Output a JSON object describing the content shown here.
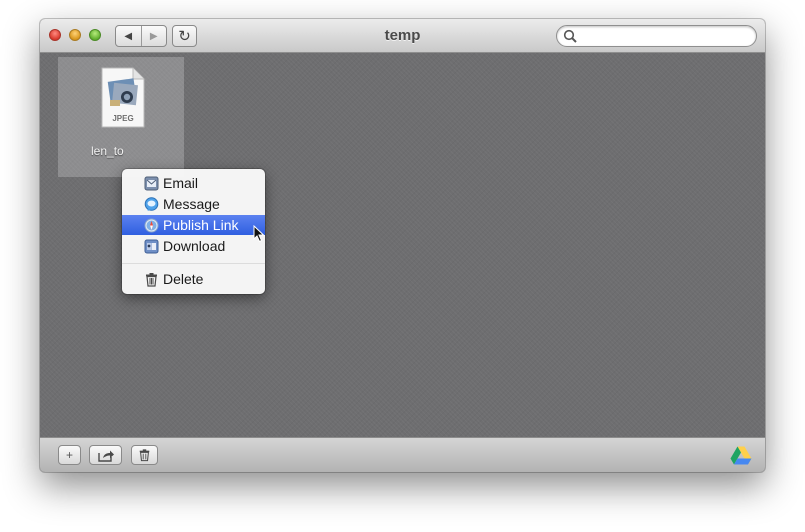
{
  "window": {
    "title": "temp"
  },
  "toolbar": {
    "back_icon": "back-arrow-icon",
    "forward_icon": "forward-arrow-icon",
    "refresh_icon": "refresh-icon"
  },
  "search": {
    "value": "",
    "placeholder": "",
    "icon": "search-icon"
  },
  "file": {
    "name": "len_to",
    "icon_label": "JPEG",
    "icon": "jpeg-file-icon"
  },
  "context_menu": {
    "items": [
      {
        "label": "Email",
        "icon": "mail-icon",
        "selected": false
      },
      {
        "label": "Message",
        "icon": "message-bubble-icon",
        "selected": false
      },
      {
        "label": "Publish Link",
        "icon": "safari-compass-icon",
        "selected": true
      },
      {
        "label": "Download",
        "icon": "download-icon",
        "selected": false
      },
      {
        "label": "Delete",
        "icon": "trash-icon",
        "selected": false
      }
    ]
  },
  "bottombar": {
    "add_symbol": "+",
    "share_icon": "share-icon",
    "trash_icon": "trash-icon",
    "logo_icon": "google-drive-icon"
  },
  "colors": {
    "selection": "#3b6ae6",
    "background": "#6e6e70",
    "drive_green": "#1fa463",
    "drive_yellow": "#ffd04b",
    "drive_blue": "#4688f1"
  }
}
